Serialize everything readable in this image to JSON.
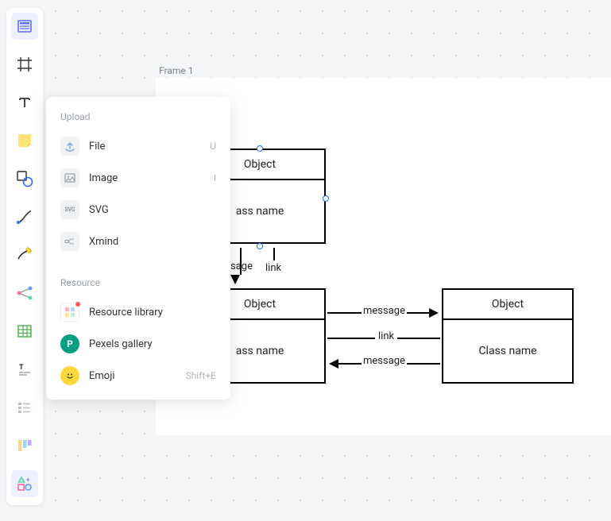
{
  "frame": {
    "label": "Frame 1"
  },
  "flyout": {
    "upload_title": "Upload",
    "file_label": "File",
    "file_shortcut": "U",
    "image_label": "Image",
    "image_shortcut": "I",
    "svg_label": "SVG",
    "xmind_label": "Xmind",
    "resource_title": "Resource",
    "resource_library_label": "Resource library",
    "pexels_label": "Pexels gallery",
    "emoji_label": "Emoji",
    "emoji_shortcut": "Shift+E"
  },
  "diagram": {
    "box1_title": "Object",
    "box1_body": "ass name",
    "box2_title": "Object",
    "box2_body": "ass name",
    "box3_title": "Object",
    "box3_body": "Class name",
    "msg1": "sage",
    "link1": "link",
    "msg2": "message",
    "link2": "link",
    "msg3": "message"
  },
  "colors": {
    "accent": "#5b6cff",
    "handle": "#2a6df4"
  }
}
